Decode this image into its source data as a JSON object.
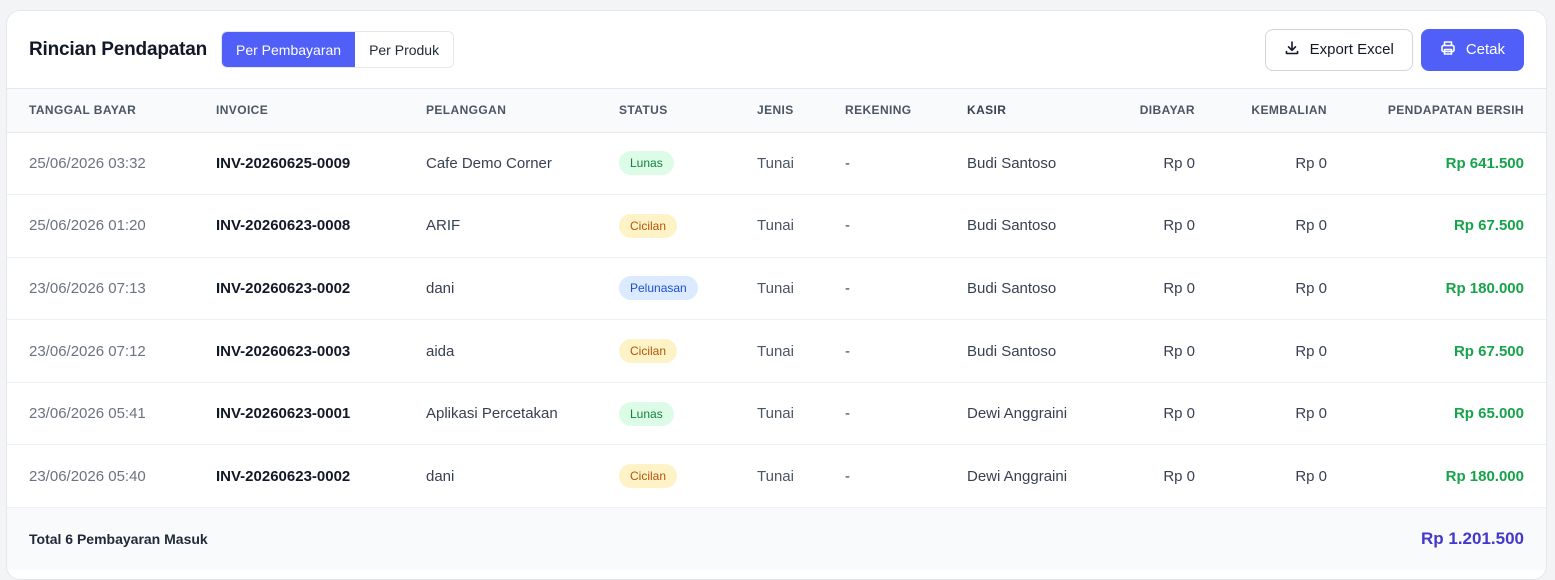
{
  "header": {
    "title": "Rincian Pendapatan",
    "tabs": [
      {
        "label": "Per Pembayaran",
        "active": true
      },
      {
        "label": "Per Produk",
        "active": false
      }
    ],
    "export_label": "Export Excel",
    "print_label": "Cetak"
  },
  "table": {
    "columns": [
      "TANGGAL BAYAR",
      "INVOICE",
      "PELANGGAN",
      "STATUS",
      "JENIS",
      "REKENING",
      "KASIR",
      "DIBAYAR",
      "KEMBALIAN",
      "PENDAPATAN BERSIH"
    ],
    "rows": [
      {
        "date": "25/06/2026 03:32",
        "invoice": "INV-20260625-0009",
        "customer": "Cafe Demo Corner",
        "status": "Lunas",
        "jenis": "Tunai",
        "rekening": "-",
        "kasir": "Budi Santoso",
        "dibayar": "Rp 0",
        "kembalian": "Rp 0",
        "net": "Rp 641.500"
      },
      {
        "date": "25/06/2026 01:20",
        "invoice": "INV-20260623-0008",
        "customer": "ARIF",
        "status": "Cicilan",
        "jenis": "Tunai",
        "rekening": "-",
        "kasir": "Budi Santoso",
        "dibayar": "Rp 0",
        "kembalian": "Rp 0",
        "net": "Rp 67.500"
      },
      {
        "date": "23/06/2026 07:13",
        "invoice": "INV-20260623-0002",
        "customer": "dani",
        "status": "Pelunasan",
        "jenis": "Tunai",
        "rekening": "-",
        "kasir": "Budi Santoso",
        "dibayar": "Rp 0",
        "kembalian": "Rp 0",
        "net": "Rp 180.000"
      },
      {
        "date": "23/06/2026 07:12",
        "invoice": "INV-20260623-0003",
        "customer": "aida",
        "status": "Cicilan",
        "jenis": "Tunai",
        "rekening": "-",
        "kasir": "Budi Santoso",
        "dibayar": "Rp 0",
        "kembalian": "Rp 0",
        "net": "Rp 67.500"
      },
      {
        "date": "23/06/2026 05:41",
        "invoice": "INV-20260623-0001",
        "customer": "Aplikasi Percetakan",
        "status": "Lunas",
        "jenis": "Tunai",
        "rekening": "-",
        "kasir": "Dewi Anggraini",
        "dibayar": "Rp 0",
        "kembalian": "Rp 0",
        "net": "Rp 65.000"
      },
      {
        "date": "23/06/2026 05:40",
        "invoice": "INV-20260623-0002",
        "customer": "dani",
        "status": "Cicilan",
        "jenis": "Tunai",
        "rekening": "-",
        "kasir": "Dewi Anggraini",
        "dibayar": "Rp 0",
        "kembalian": "Rp 0",
        "net": "Rp 180.000"
      }
    ]
  },
  "footer": {
    "label": "Total 6 Pembayaran Masuk",
    "total": "Rp 1.201.500"
  },
  "colors": {
    "accent": "#4f5ff7",
    "positive": "#16a34a",
    "total": "#4338ca"
  }
}
